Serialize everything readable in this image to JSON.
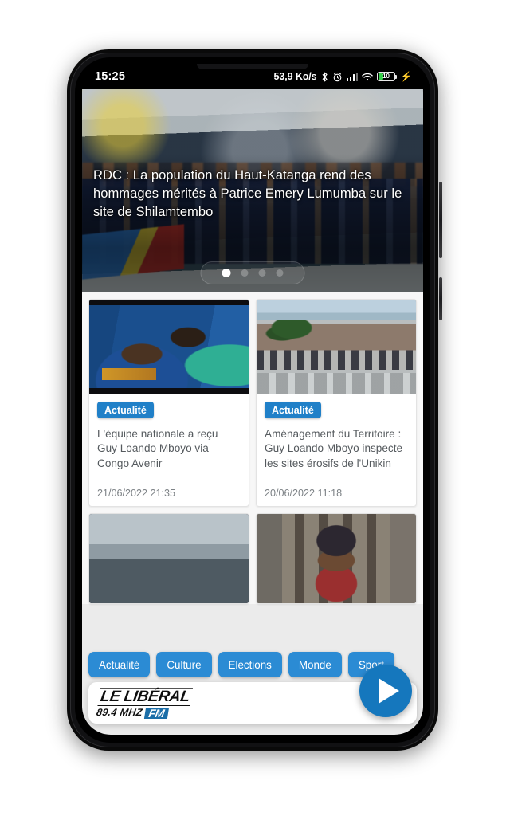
{
  "status_bar": {
    "clock": "15:25",
    "network_speed": "53,9 Ko/s",
    "bluetooth_icon": "bluetooth-icon",
    "alarm_icon": "alarm-icon",
    "signal_icon": "cellular-signal-icon",
    "wifi_icon": "wifi-icon",
    "battery_level": "10",
    "charging_icon": "charging-bolt-icon"
  },
  "hero": {
    "title": "RDC : La population du Haut-Katanga rend des hommages mérités à Patrice Emery Lumumba sur le site de Shilamtembo",
    "dots": [
      {
        "active": true
      },
      {
        "active": false
      },
      {
        "active": false
      },
      {
        "active": false
      }
    ]
  },
  "feed": {
    "row1": [
      {
        "image": "tv-interview-photo",
        "badge": "Actualité",
        "title": "L'équipe nationale a reçu Guy Loando Mboyo via Congo Avenir",
        "date": "21/06/2022 21:35"
      },
      {
        "image": "campus-march-photo",
        "badge": "Actualité",
        "title": "Aménagement du Territoire : Guy Loando Mboyo inspecte les sites érosifs de l'Unikin",
        "date": "20/06/2022 11:18"
      }
    ],
    "row2": [
      {
        "image": "officials-handshake-photo"
      },
      {
        "image": "soldier-portrait-photo"
      }
    ]
  },
  "categories": [
    {
      "label": "Actualité"
    },
    {
      "label": "Culture"
    },
    {
      "label": "Elections"
    },
    {
      "label": "Monde"
    },
    {
      "label": "Sport"
    }
  ],
  "bottom_bar": {
    "logo_name": "LE LIBÉRAL",
    "logo_freq": "89.4 MHZ",
    "logo_fm": "FM",
    "play_icon": "play-icon"
  },
  "colors": {
    "badge_blue": "#2080c8",
    "chip_blue": "#2b8bd4",
    "fab_blue": "#1577bd",
    "logo_fm_blue": "#1b6ea8",
    "battery_green": "#36d04a"
  }
}
